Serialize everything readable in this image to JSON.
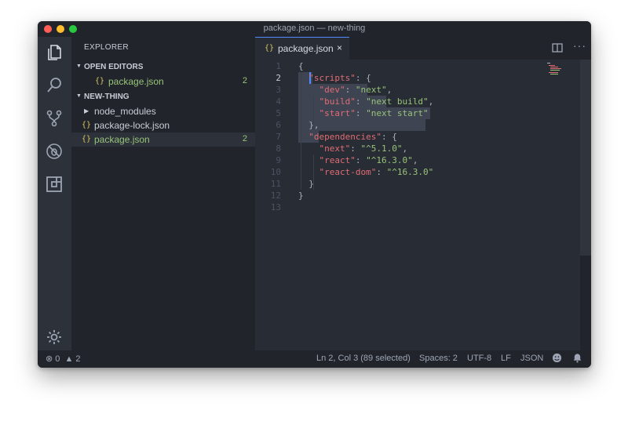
{
  "window": {
    "title": "package.json — new-thing"
  },
  "sidebar": {
    "title": "EXPLORER",
    "open_editors": {
      "label": "OPEN EDITORS",
      "items": [
        {
          "name": "package.json",
          "badge": "2"
        }
      ]
    },
    "project": {
      "label": "NEW-THING",
      "items": [
        {
          "name": "node_modules"
        },
        {
          "name": "package-lock.json"
        },
        {
          "name": "package.json",
          "badge": "2"
        }
      ]
    }
  },
  "editor": {
    "tab": {
      "name": "package.json",
      "close": "×"
    },
    "more": "···",
    "line_numbers": [
      "1",
      "2",
      "3",
      "4",
      "5",
      "6",
      "7",
      "8",
      "9",
      "10",
      "11",
      "12",
      "13"
    ],
    "code": {
      "l1": "{",
      "scripts_key": "\"scripts\"",
      "dev_key": "\"dev\"",
      "dev_val": "\"next\"",
      "build_key": "\"build\"",
      "build_val": "\"next build\"",
      "start_key": "\"start\"",
      "start_val": "\"next start\"",
      "l6": "},",
      "deps_key": "\"dependencies\"",
      "next_key": "\"next\"",
      "next_val": "\"^5.1.0\"",
      "react_key": "\"react\"",
      "react_val": "\"^16.3.0\"",
      "reactdom_key": "\"react-dom\"",
      "reactdom_val": "\"^16.3.0\"",
      "l11": "}",
      "l12": "}"
    }
  },
  "statusbar": {
    "errors": "0",
    "warnings": "2",
    "position": "Ln 2, Col 3 (89 selected)",
    "spaces": "Spaces: 2",
    "encoding": "UTF-8",
    "eol": "LF",
    "language": "JSON"
  },
  "colors": {
    "accent": "#528bff",
    "modified": "#98c379",
    "json_key": "#e06c75",
    "json_string": "#98c379"
  },
  "icons": [
    "files-icon",
    "search-icon",
    "source-control-icon",
    "debug-icon",
    "extensions-icon",
    "gear-icon",
    "split-editor-icon",
    "more-icon",
    "error-icon",
    "warning-icon",
    "smiley-icon",
    "bell-icon"
  ]
}
